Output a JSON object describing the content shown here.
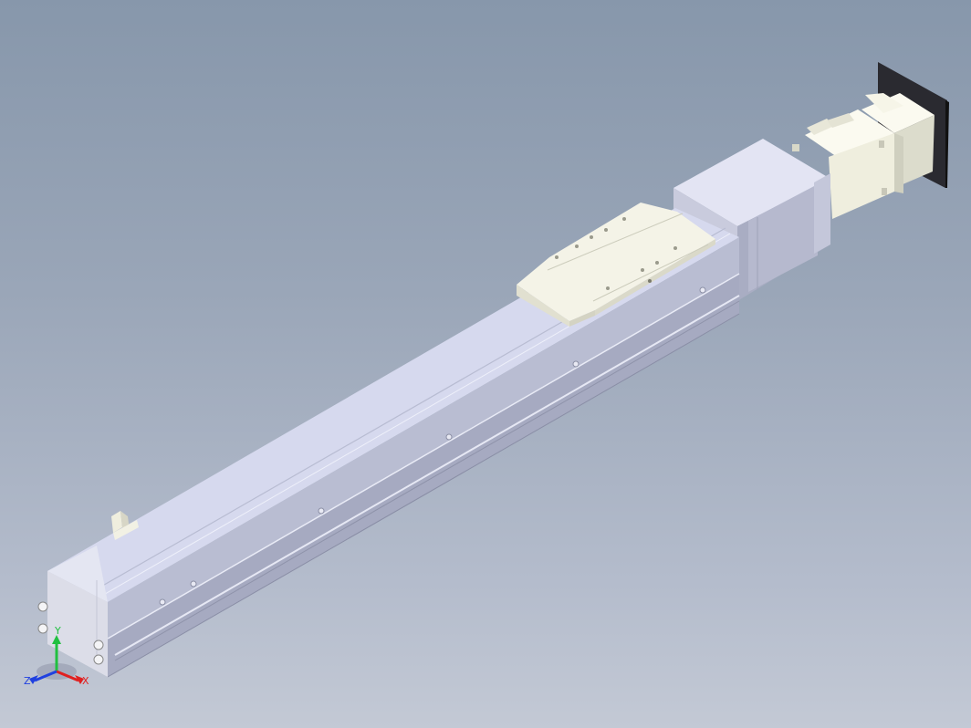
{
  "viewport": {
    "background_top": "#8797ab",
    "background_bottom": "#c3c9d5"
  },
  "model": {
    "part_colors": {
      "body": "#d8dbee",
      "body_side": "#b4b8cc",
      "carriage": "#f1f0e3",
      "motor": "#f3f2e4",
      "motor_flange": "#2a2a30"
    }
  },
  "triad": {
    "x_label": "X",
    "y_label": "Y",
    "z_label": "Z",
    "x_color": "#e02020",
    "y_color": "#20c040",
    "z_color": "#2040e0"
  }
}
